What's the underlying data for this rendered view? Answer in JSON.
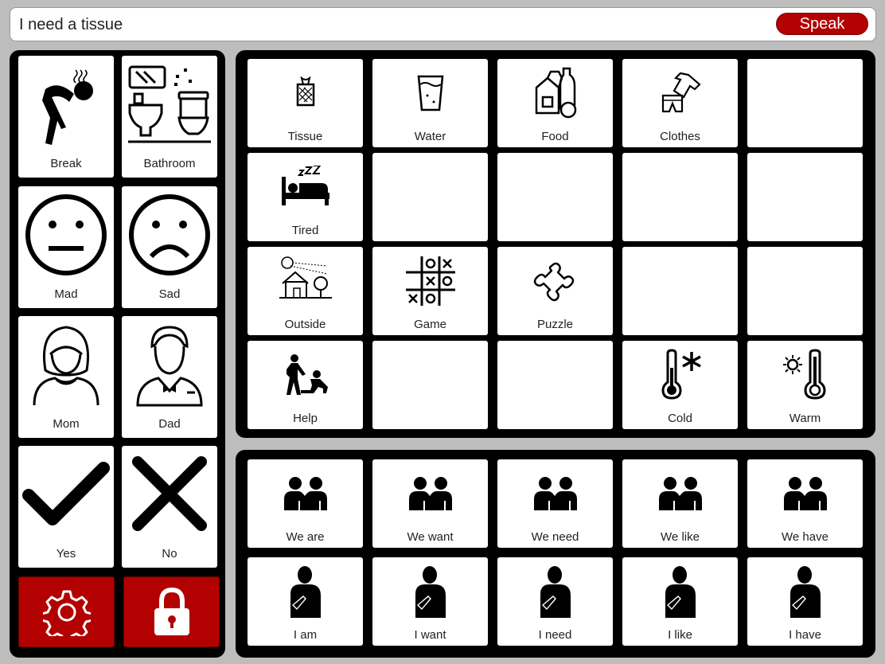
{
  "speech": {
    "text": "I need a tissue",
    "speak_label": "Speak"
  },
  "colors": {
    "accent": "#b30000",
    "background": "#bdbdbd",
    "panel": "#000000",
    "tile": "#ffffff"
  },
  "left_panel": {
    "tiles": [
      {
        "label": "Break",
        "icon": "break-person-icon"
      },
      {
        "label": "Bathroom",
        "icon": "bathroom-icon"
      },
      {
        "label": "Mad",
        "icon": "neutral-face-icon"
      },
      {
        "label": "Sad",
        "icon": "sad-face-icon"
      },
      {
        "label": "Mom",
        "icon": "mom-avatar-icon"
      },
      {
        "label": "Dad",
        "icon": "dad-avatar-icon"
      },
      {
        "label": "Yes",
        "icon": "check-icon"
      },
      {
        "label": "No",
        "icon": "x-mark-icon"
      }
    ],
    "settings_icon": "gear-icon",
    "lock_icon": "padlock-icon"
  },
  "main_grid": {
    "tiles": [
      {
        "label": "Tissue",
        "icon": "tissue-box-icon"
      },
      {
        "label": "Water",
        "icon": "water-glass-icon"
      },
      {
        "label": "Food",
        "icon": "food-icon"
      },
      {
        "label": "Clothes",
        "icon": "clothes-icon"
      },
      {
        "label": "",
        "icon": ""
      },
      {
        "label": "Tired",
        "icon": "bed-sleep-icon"
      },
      {
        "label": "",
        "icon": ""
      },
      {
        "label": "",
        "icon": ""
      },
      {
        "label": "",
        "icon": ""
      },
      {
        "label": "",
        "icon": ""
      },
      {
        "label": "Outside",
        "icon": "house-outside-icon"
      },
      {
        "label": "Game",
        "icon": "tic-tac-toe-icon"
      },
      {
        "label": "Puzzle",
        "icon": "puzzle-piece-icon"
      },
      {
        "label": "",
        "icon": ""
      },
      {
        "label": "",
        "icon": ""
      },
      {
        "label": "Help",
        "icon": "helping-person-icon"
      },
      {
        "label": "",
        "icon": ""
      },
      {
        "label": "",
        "icon": ""
      },
      {
        "label": "Cold",
        "icon": "cold-thermometer-icon"
      },
      {
        "label": "Warm",
        "icon": "warm-thermometer-icon"
      }
    ]
  },
  "phrases": {
    "we": [
      {
        "label": "We are",
        "icon": "two-people-icon"
      },
      {
        "label": "We want",
        "icon": "two-people-icon"
      },
      {
        "label": "We need",
        "icon": "two-people-icon"
      },
      {
        "label": "We like",
        "icon": "two-people-icon"
      },
      {
        "label": "We have",
        "icon": "two-people-icon"
      }
    ],
    "i": [
      {
        "label": "I am",
        "icon": "self-pointing-icon"
      },
      {
        "label": "I want",
        "icon": "self-pointing-icon"
      },
      {
        "label": "I need",
        "icon": "self-pointing-icon"
      },
      {
        "label": "I like",
        "icon": "self-pointing-icon"
      },
      {
        "label": "I have",
        "icon": "self-pointing-icon"
      }
    ]
  }
}
